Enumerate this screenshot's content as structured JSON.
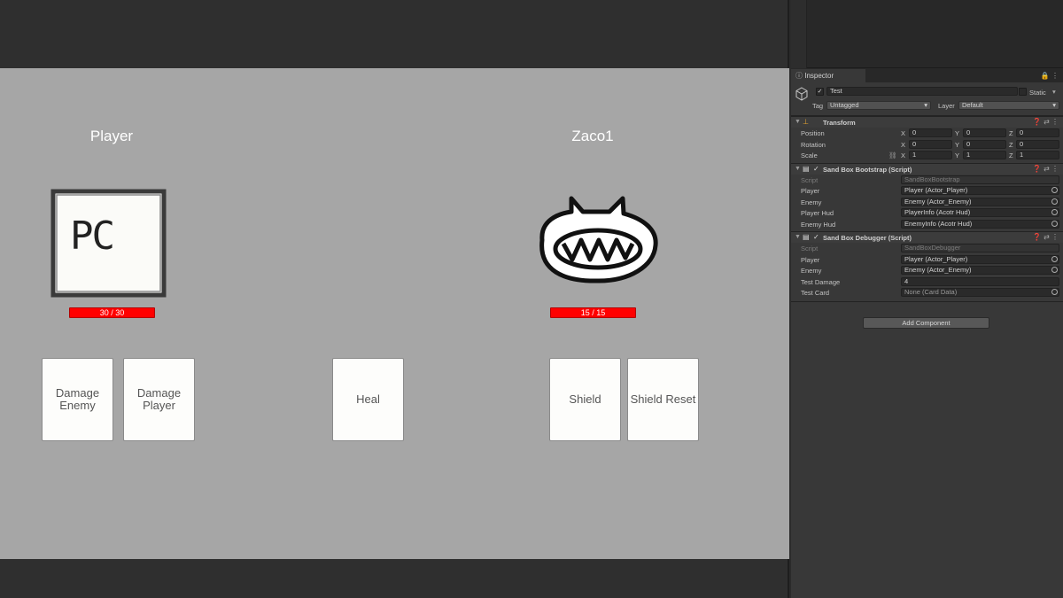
{
  "game": {
    "player": {
      "name": "Player",
      "hp": "30 / 30",
      "portrait_text": "PC"
    },
    "enemy": {
      "name": "Zaco1",
      "hp": "15 / 15"
    },
    "cards": [
      {
        "label": "Damage Enemy"
      },
      {
        "label": "Damage Player"
      },
      {
        "label": "Heal"
      },
      {
        "label": "Shield"
      },
      {
        "label": "Shield Reset"
      }
    ]
  },
  "inspector": {
    "tab": "Inspector",
    "object_name": "Test",
    "static_label": "Static",
    "tag_label": "Tag",
    "tag_value": "Untagged",
    "layer_label": "Layer",
    "layer_value": "Default",
    "transform": {
      "title": "Transform",
      "position_label": "Position",
      "rotation_label": "Rotation",
      "scale_label": "Scale",
      "axis_x": "X",
      "axis_y": "Y",
      "axis_z": "Z",
      "position": [
        "0",
        "0",
        "0"
      ],
      "rotation": [
        "0",
        "0",
        "0"
      ],
      "scale": [
        "1",
        "1",
        "1"
      ]
    },
    "bootstrap": {
      "title": "Sand Box Bootstrap (Script)",
      "rows": [
        {
          "label": "Script",
          "value": "SandBoxBootstrap"
        },
        {
          "label": "Player",
          "value": "Player (Actor_Player)"
        },
        {
          "label": "Enemy",
          "value": "Enemy (Actor_Enemy)"
        },
        {
          "label": "Player Hud",
          "value": "PlayerInfo (Acotr Hud)"
        },
        {
          "label": "Enemy Hud",
          "value": "EnemyInfo (Acotr Hud)"
        }
      ]
    },
    "debugger": {
      "title": "Sand Box Debugger (Script)",
      "rows": [
        {
          "label": "Script",
          "value": "SandBoxDebugger"
        },
        {
          "label": "Player",
          "value": "Player (Actor_Player)"
        },
        {
          "label": "Enemy",
          "value": "Enemy (Actor_Enemy)"
        },
        {
          "label": "Test Damage",
          "value": "4"
        },
        {
          "label": "Test Card",
          "value": "None (Card Data)"
        }
      ]
    },
    "add_component": "Add Component"
  }
}
